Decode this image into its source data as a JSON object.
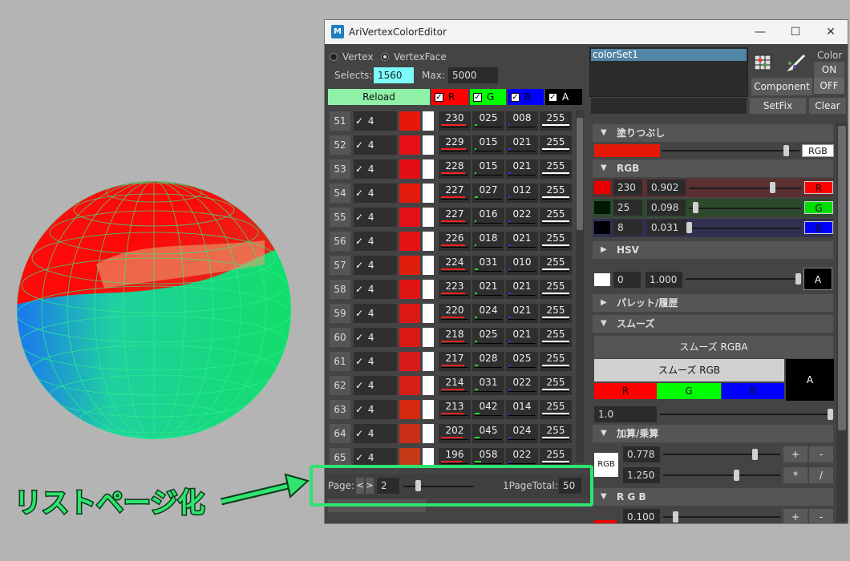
{
  "window": {
    "title": "AriVertexColorEditor",
    "app_icon": "maya-icon"
  },
  "mode": {
    "vertex_label": "Vertex",
    "vertexface_label": "VertexFace",
    "selected": "VertexFace"
  },
  "selects": {
    "label": "Selects:",
    "value": "1560",
    "max_label": "Max:",
    "max_value": "5000"
  },
  "reload_label": "Reload",
  "channels": [
    {
      "label": "R",
      "color": "#ff0000",
      "checked": true
    },
    {
      "label": "G",
      "color": "#00ff00",
      "checked": true
    },
    {
      "label": "B",
      "color": "#0000ff",
      "checked": true
    },
    {
      "label": "A",
      "color": "#000000",
      "checked": true
    }
  ],
  "rows": [
    {
      "index": "51",
      "count": "4",
      "swatch": "#e61908",
      "r": "230",
      "g": "025",
      "b": "008",
      "a": "255"
    },
    {
      "index": "52",
      "count": "4",
      "swatch": "#e50f15",
      "r": "229",
      "g": "015",
      "b": "021",
      "a": "255"
    },
    {
      "index": "53",
      "count": "4",
      "swatch": "#e40f15",
      "r": "228",
      "g": "015",
      "b": "021",
      "a": "255"
    },
    {
      "index": "54",
      "count": "4",
      "swatch": "#e31b0c",
      "r": "227",
      "g": "027",
      "b": "012",
      "a": "255"
    },
    {
      "index": "55",
      "count": "4",
      "swatch": "#e31016",
      "r": "227",
      "g": "016",
      "b": "022",
      "a": "255"
    },
    {
      "index": "56",
      "count": "4",
      "swatch": "#e21215",
      "r": "226",
      "g": "018",
      "b": "021",
      "a": "255"
    },
    {
      "index": "57",
      "count": "4",
      "swatch": "#e01f0a",
      "r": "224",
      "g": "031",
      "b": "010",
      "a": "255"
    },
    {
      "index": "58",
      "count": "4",
      "swatch": "#df1515",
      "r": "223",
      "g": "021",
      "b": "021",
      "a": "255"
    },
    {
      "index": "59",
      "count": "4",
      "swatch": "#dc1815",
      "r": "220",
      "g": "024",
      "b": "021",
      "a": "255"
    },
    {
      "index": "60",
      "count": "4",
      "swatch": "#da1915",
      "r": "218",
      "g": "025",
      "b": "021",
      "a": "255"
    },
    {
      "index": "61",
      "count": "4",
      "swatch": "#d91c19",
      "r": "217",
      "g": "028",
      "b": "025",
      "a": "255"
    },
    {
      "index": "62",
      "count": "4",
      "swatch": "#d61f16",
      "r": "214",
      "g": "031",
      "b": "022",
      "a": "255"
    },
    {
      "index": "63",
      "count": "4",
      "swatch": "#d52a0e",
      "r": "213",
      "g": "042",
      "b": "014",
      "a": "255"
    },
    {
      "index": "64",
      "count": "4",
      "swatch": "#ca2d18",
      "r": "202",
      "g": "045",
      "b": "024",
      "a": "255"
    },
    {
      "index": "65",
      "count": "4",
      "swatch": "#c43a16",
      "r": "196",
      "g": "058",
      "b": "022",
      "a": "255"
    }
  ],
  "paging": {
    "page_label": "Page:",
    "prev": "<",
    "next": ">",
    "page": "2",
    "page_slider": 0.2,
    "total_label": "1PageTotal:",
    "total_value": "50"
  },
  "colorset": {
    "item": "colorSet1",
    "component_label": "Component",
    "color_label": "Color",
    "on_label": "ON",
    "off_label": "OFF",
    "setfix_label": "SetFix",
    "clear_label": "Clear"
  },
  "fill": {
    "title": "塗りつぶし",
    "swatch": "#e61908",
    "mode_label": "RGB",
    "level": 0.9
  },
  "rgb": {
    "title": "RGB",
    "channels": [
      {
        "int": "230",
        "float": "0.902",
        "swatch": "#e60000",
        "btn": "R",
        "btn_color": "#ff0000",
        "band": "#5a3030",
        "level": 0.902
      },
      {
        "int": "25",
        "float": "0.098",
        "swatch": "#001900",
        "btn": "G",
        "btn_color": "#00dd00",
        "band": "#2e4a2e",
        "level": 0.098
      },
      {
        "int": "8",
        "float": "0.031",
        "swatch": "#000008",
        "btn": "B",
        "btn_color": "#0000ff",
        "band": "#303050",
        "level": 0.031
      }
    ]
  },
  "hsv": {
    "title": "HSV"
  },
  "alpha": {
    "int": "0",
    "float": "1.000",
    "btn": "A",
    "level": 1.0
  },
  "palette": {
    "title": "パレット/履歴"
  },
  "smooth": {
    "title": "スムーズ",
    "rgba_label": "スムーズ RGBA",
    "rgb_label": "スムーズ RGB",
    "r": "R",
    "g": "G",
    "b": "B",
    "a": "A",
    "value": "1.0",
    "level": 1.0
  },
  "addmul": {
    "title": "加算/乗算",
    "rgb_icon_label": "RGB",
    "add_value": "0.778",
    "add_level": 0.778,
    "mul_value": "1.250",
    "mul_level": 0.62,
    "plus": "+",
    "minus": "-",
    "times": "*",
    "div": "/"
  },
  "rgb2": {
    "title": "R G B",
    "value": "0.100",
    "level": 0.1,
    "plus": "+",
    "minus": "-"
  },
  "annotation": {
    "text": "リストページ化"
  }
}
